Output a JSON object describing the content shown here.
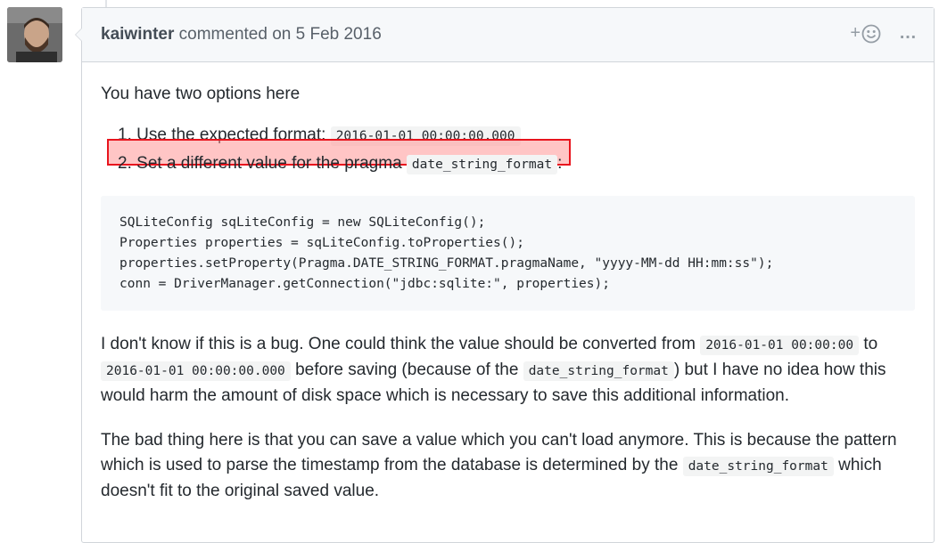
{
  "header": {
    "author": "kaiwinter",
    "action": "commented on",
    "date": "5 Feb 2016",
    "reaction_plus": "+",
    "more_actions": "…"
  },
  "body": {
    "intro": "You have two options here",
    "list": [
      {
        "number": "1.",
        "text": "Use the expected format:",
        "code": "2016-01-01 00:00:00.000",
        "suffix": ""
      },
      {
        "number": "2.",
        "text": "Set a different value for the pragma",
        "code": "date_string_format",
        "suffix": ":"
      }
    ],
    "code_lines": [
      "SQLiteConfig sqLiteConfig = new SQLiteConfig();",
      "Properties properties = sqLiteConfig.toProperties();",
      "properties.setProperty(Pragma.DATE_STRING_FORMAT.pragmaName, \"yyyy-MM-dd HH:mm:ss\");",
      "conn = DriverManager.getConnection(\"jdbc:sqlite:\", properties);"
    ],
    "para1": {
      "t1": "I don't know if this is a bug. One could think the value should be converted from",
      "c1": "2016-01-01 00:00:00",
      "t2": "to",
      "c2": "2016-01-01 00:00:00.000",
      "t3": "before saving (because of the",
      "c3": "date_string_format",
      "t4": ") but I have no idea how this would harm the amount of disk space which is necessary to save this additional information."
    },
    "para2": {
      "t1": "The bad thing here is that you can save a value which you can't load anymore. This is because the pattern which is used to parse the timestamp from the database is determined by the",
      "c1": "date_string_format",
      "t2": "which doesn't fit to the original saved value."
    }
  },
  "colors": {
    "highlight_border": "#e8141d",
    "highlight_fill": "#ff9696",
    "header_bg": "#f6f8fa",
    "code_bg": "#f6f8fa"
  }
}
